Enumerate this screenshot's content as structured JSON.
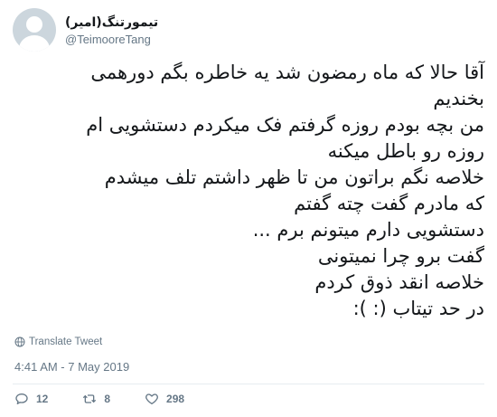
{
  "author": {
    "display_name": "تیمورتنگ(امیر)",
    "handle": "@TeimooreTang"
  },
  "tweet": {
    "lines": [
      "آقا حالا که ماه رمضون شد یه خاطره بگم دورهمی",
      "بخندیم",
      "من بچه بودم روزه گرفتم فک میکردم دستشویی ام",
      "روزه رو باطل میکنه",
      "خلاصه نگم براتون من تا ظهر داشتم تلف میشدم",
      "که مادرم گفت چته گفتم",
      "دستشویی دارم میتونم برم ...",
      "گفت برو چرا نمیتونی",
      "خلاصه انقد ذوق کردم",
      "در حد تیتاب (: ):"
    ]
  },
  "translate_label": "Translate Tweet",
  "timestamp": "4:41 AM - 7 May 2019",
  "actions": {
    "replies": "12",
    "retweets": "8",
    "likes": "298"
  },
  "icons": {
    "globe": "globe-icon",
    "reply": "reply-icon",
    "retweet": "retweet-icon",
    "like": "heart-icon",
    "avatar": "default-avatar"
  },
  "colors": {
    "text": "#14171a",
    "secondary": "#657786",
    "avatar_bg": "#ccd6dd",
    "divider": "#e6ecf0"
  }
}
